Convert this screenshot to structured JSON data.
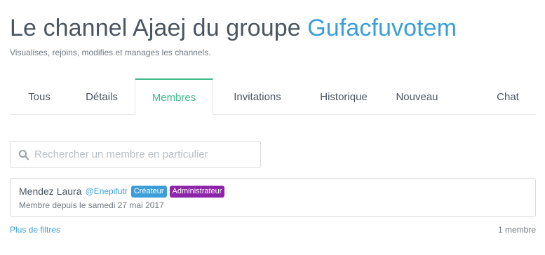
{
  "header": {
    "title_prefix": "Le channel Ajaej du groupe ",
    "group_name": "Gufacfuvotem",
    "subtitle": "Visualises, rejoins, modifies et manages les channels."
  },
  "tabs": [
    {
      "label": "Tous",
      "active": false
    },
    {
      "label": "Détails",
      "active": false
    },
    {
      "label": "Membres",
      "active": true
    },
    {
      "label": "Invitations",
      "active": false
    },
    {
      "label": "Historique",
      "active": false
    },
    {
      "label": "Nouveau",
      "active": false
    },
    {
      "label": "Chat",
      "active": false
    }
  ],
  "search": {
    "placeholder": "Rechercher un membre en particulier",
    "value": "",
    "icon": "search-icon"
  },
  "members": [
    {
      "name": "Mendez Laura",
      "handle": "@Enepifutr",
      "badges": [
        "Créateur",
        "Administrateur"
      ],
      "since": "Membre depuis le samedi 27 mai 2017"
    }
  ],
  "footer": {
    "more_filters": "Plus de filtres",
    "count": "1 membre"
  },
  "colors": {
    "accent_blue": "#3b9ed8",
    "active_tab_green": "#3dbb8a",
    "badge_creator": "#3b9ed8",
    "badge_admin": "#8e24aa",
    "text": "#4a5560"
  }
}
